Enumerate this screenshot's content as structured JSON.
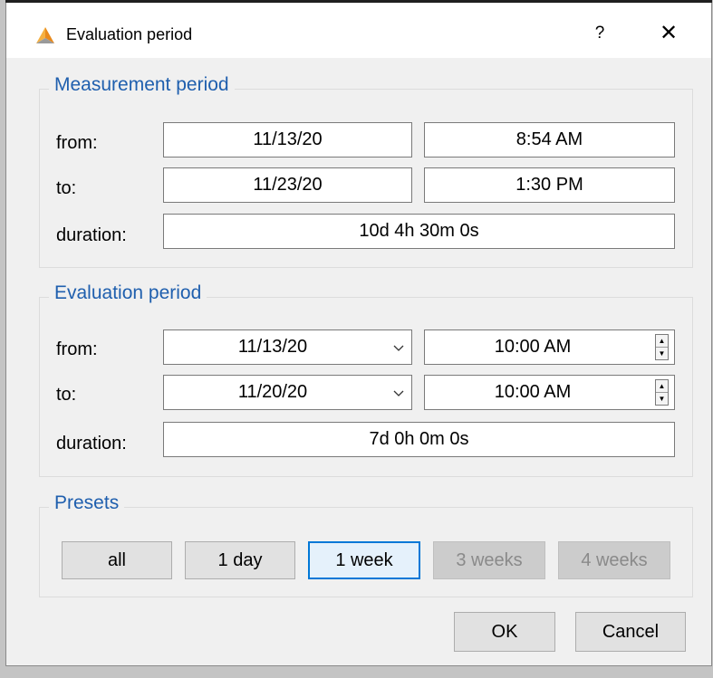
{
  "window": {
    "title": "Evaluation period",
    "help_label": "?",
    "close_label": "✕"
  },
  "measurement": {
    "legend": "Measurement period",
    "from_label": "from:",
    "from_date": "11/13/20",
    "from_time": "8:54 AM",
    "to_label": "to:",
    "to_date": "11/23/20",
    "to_time": "1:30 PM",
    "duration_label": "duration:",
    "duration": "10d 4h 30m 0s"
  },
  "evaluation": {
    "legend": "Evaluation period",
    "from_label": "from:",
    "from_date": "11/13/20",
    "from_time": "10:00 AM",
    "to_label": "to:",
    "to_date": "11/20/20",
    "to_time": "10:00 AM",
    "duration_label": "duration:",
    "duration": "7d 0h 0m 0s"
  },
  "presets": {
    "legend": "Presets",
    "all": "all",
    "one_day": "1 day",
    "one_week": "1 week",
    "three_weeks": "3 weeks",
    "four_weeks": "4 weeks",
    "selected": "1 week"
  },
  "footer": {
    "ok": "OK",
    "cancel": "Cancel"
  },
  "colors": {
    "accent": "#0078d7",
    "legend": "#1f5fae",
    "icon_orange": "#e8891c"
  }
}
